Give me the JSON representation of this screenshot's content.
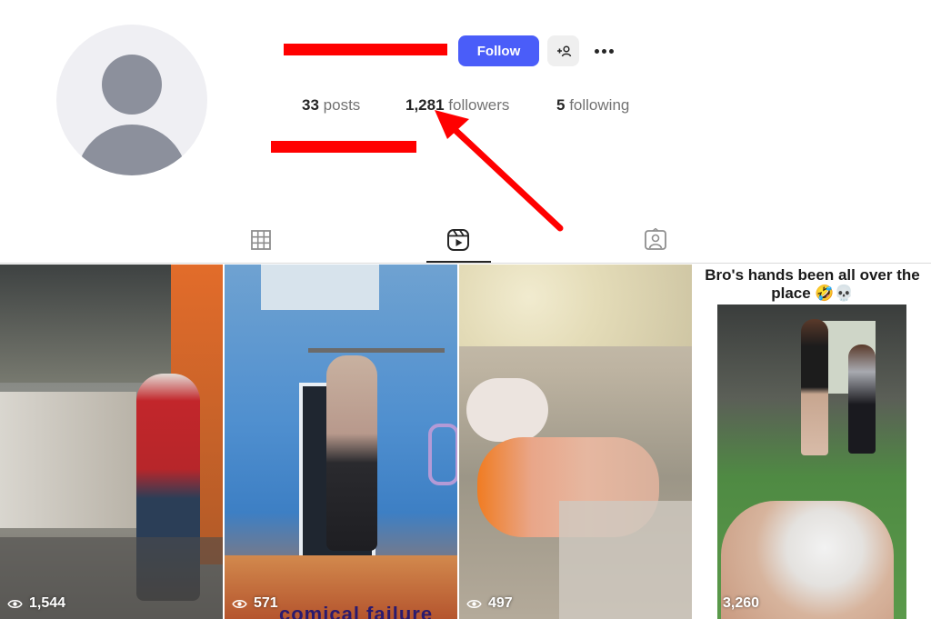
{
  "profile": {
    "follow_label": "Follow",
    "stats": {
      "posts_count": "33",
      "posts_label": "posts",
      "followers_count": "1,281",
      "followers_label": "followers",
      "following_count": "5",
      "following_label": "following"
    }
  },
  "tabs": [
    {
      "icon": "grid-icon",
      "active": false
    },
    {
      "icon": "reels-icon",
      "active": true
    },
    {
      "icon": "tagged-icon",
      "active": false
    }
  ],
  "reels": [
    {
      "views": "1,544"
    },
    {
      "views": "571",
      "overlay_text": "comical failure"
    },
    {
      "views": "497"
    },
    {
      "views": "3,260",
      "caption": "Bro's hands been all over the place 🤣💀"
    }
  ],
  "colors": {
    "follow_button": "#4a5df9",
    "annotation_red": "#ff0000"
  }
}
